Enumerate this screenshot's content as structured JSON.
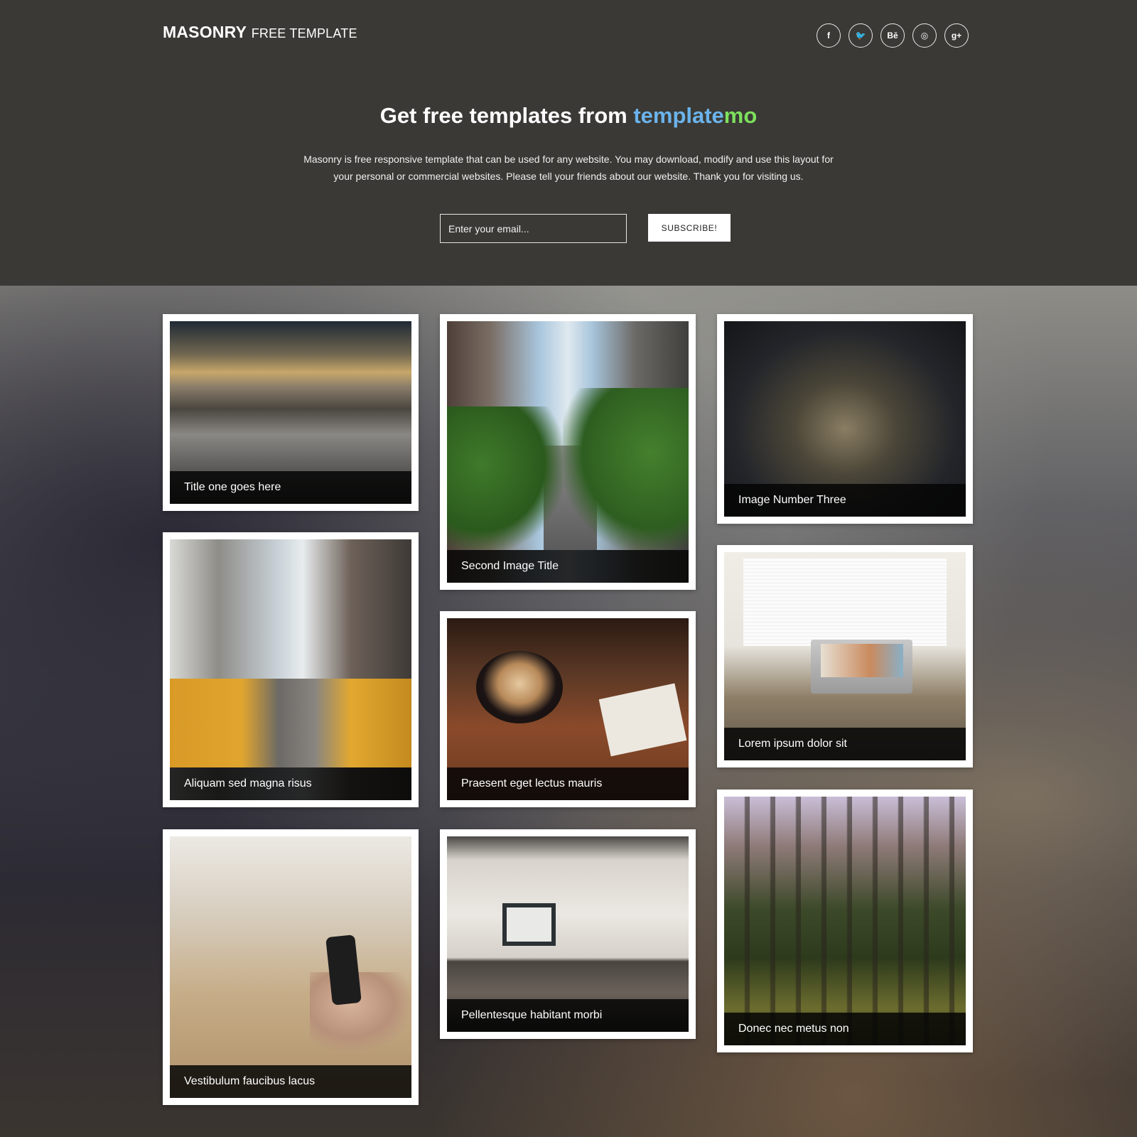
{
  "header": {
    "brand_bold": "MASONRY",
    "brand_light": "FREE TEMPLATE",
    "social": [
      {
        "icon": "facebook-icon",
        "glyph": "f"
      },
      {
        "icon": "twitter-icon",
        "glyph": "🐦"
      },
      {
        "icon": "behance-icon",
        "glyph": "Bē"
      },
      {
        "icon": "dribbble-icon",
        "glyph": "◎"
      },
      {
        "icon": "google-plus-icon",
        "glyph": "g+"
      }
    ]
  },
  "hero": {
    "title_prefix": "Get free templates from ",
    "title_accent1": "template",
    "title_accent2": "mo",
    "accent1_color": "#6bb3ec",
    "accent2_color": "#7de05d",
    "description": "Masonry is free responsive template that can be used for any website. You may download, modify and use this layout for your personal or commercial websites. Please tell your friends about our website. Thank you for visiting us.",
    "email_placeholder": "Enter your email...",
    "subscribe_label": "SUBSCRIBE!"
  },
  "gallery": {
    "items": [
      {
        "title": "Title one goes here"
      },
      {
        "title": "Second Image Title"
      },
      {
        "title": "Image Number Three"
      },
      {
        "title": "Aliquam sed magna risus"
      },
      {
        "title": "Praesent eget lectus mauris"
      },
      {
        "title": "Lorem ipsum dolor sit"
      },
      {
        "title": "Vestibulum faucibus lacus"
      },
      {
        "title": "Pellentesque habitant morbi"
      },
      {
        "title": "Donec nec metus non"
      }
    ]
  }
}
